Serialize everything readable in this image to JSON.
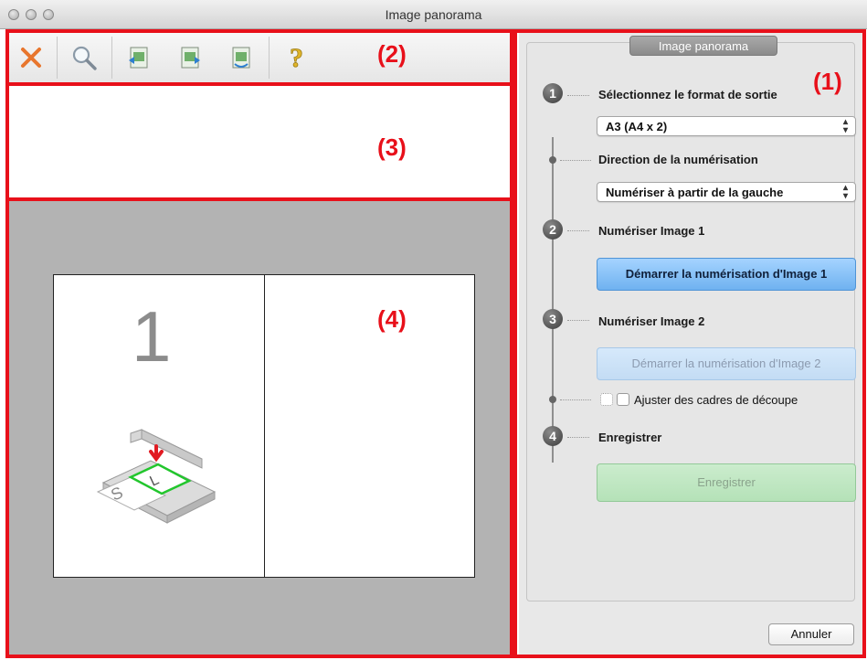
{
  "window": {
    "title": "Image panorama"
  },
  "toolbar": {
    "buttons": [
      {
        "icon": "close-icon"
      },
      {
        "icon": "zoom-icon"
      },
      {
        "icon": "image-left-icon"
      },
      {
        "icon": "image-right-icon"
      },
      {
        "icon": "image-swap-icon"
      },
      {
        "icon": "help-icon"
      }
    ]
  },
  "annotations": {
    "a1": "(1)",
    "a2": "(2)",
    "a3": "(3)",
    "a4": "(4)"
  },
  "preview": {
    "slot_number": "1"
  },
  "panel": {
    "tab_title": "Image panorama",
    "steps": [
      {
        "number": "1",
        "label": "Sélectionnez le format de sortie"
      },
      {
        "number": "2",
        "label": "Numériser Image 1"
      },
      {
        "number": "3",
        "label": "Numériser Image 2"
      },
      {
        "number": "4",
        "label": "Enregistrer"
      }
    ],
    "output_format_value": "A3 (A4 x 2)",
    "scan_direction_label": "Direction de la numérisation",
    "scan_direction_value": "Numériser à partir de la gauche",
    "start_scan_1": "Démarrer la numérisation d'Image 1",
    "start_scan_2": "Démarrer la numérisation d'Image 2",
    "crop_frames_label": "Ajuster des cadres de découpe",
    "save_button": "Enregistrer",
    "cancel_button": "Annuler"
  },
  "colors": {
    "annotation": "#e8101a",
    "primary_button": "#6fb2f0",
    "save_button": "#b5e2b8"
  }
}
